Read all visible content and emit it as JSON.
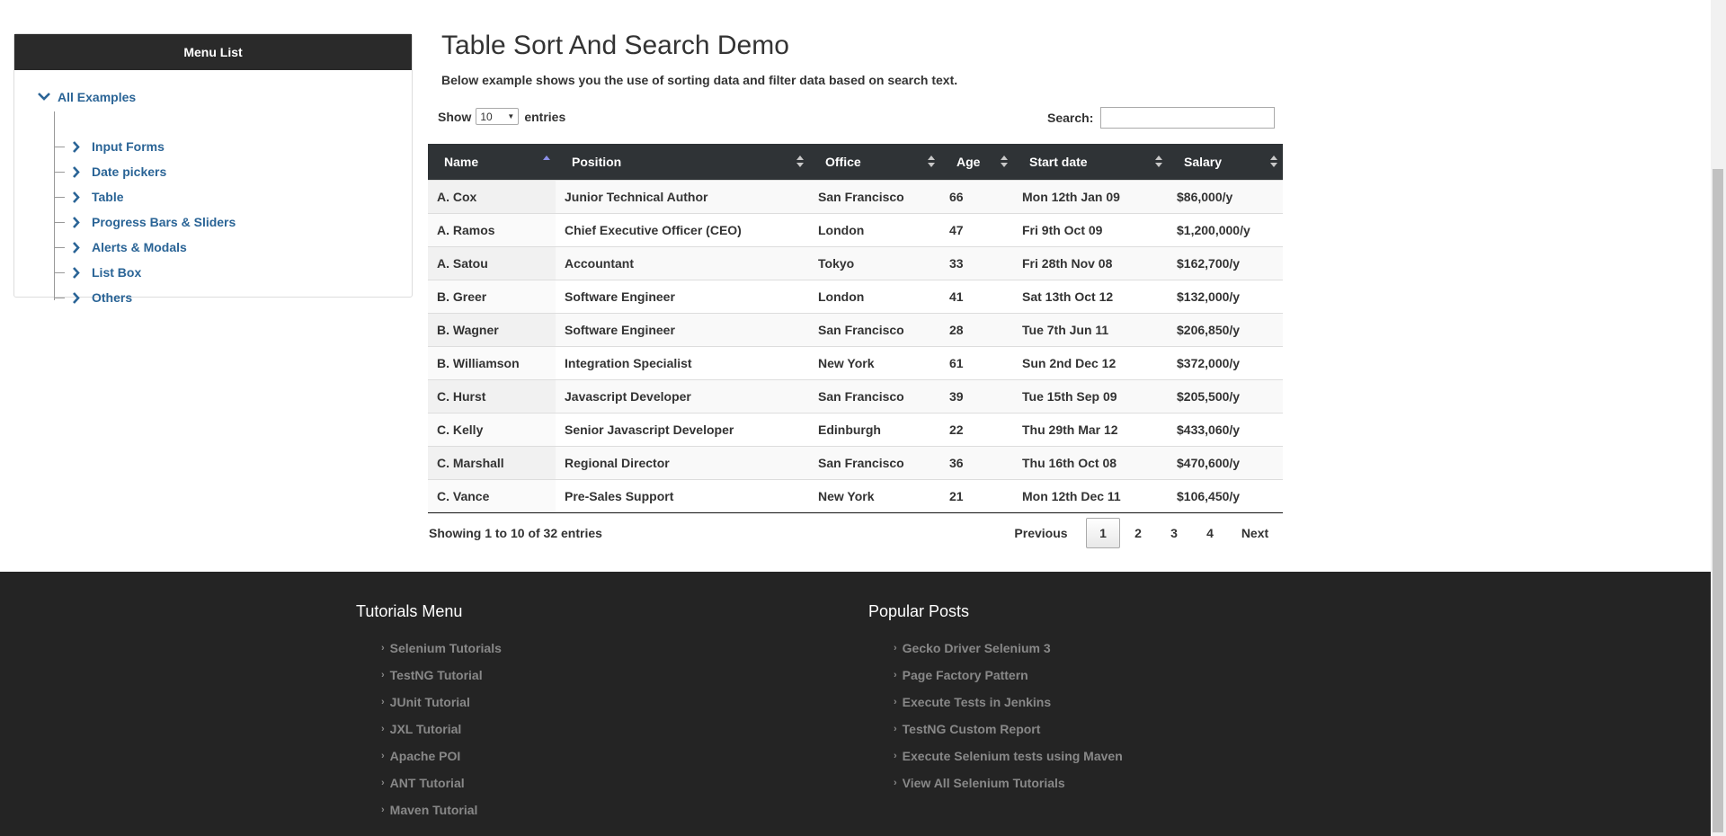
{
  "menu": {
    "title": "Menu List",
    "root_label": "All Examples",
    "items": [
      {
        "label": "Input Forms"
      },
      {
        "label": "Date pickers"
      },
      {
        "label": "Table"
      },
      {
        "label": "Progress Bars & Sliders"
      },
      {
        "label": "Alerts & Modals"
      },
      {
        "label": "List Box"
      },
      {
        "label": "Others"
      }
    ]
  },
  "main": {
    "title": "Table Sort And Search Demo",
    "description": "Below example shows you the use of sorting data and filter data based on search text.",
    "show_label": "Show",
    "entries_value": "10",
    "entries_label": "entries",
    "search_label": "Search:",
    "search_value": ""
  },
  "table": {
    "columns": [
      "Name",
      "Position",
      "Office",
      "Age",
      "Start date",
      "Salary"
    ],
    "rows": [
      [
        "A. Cox",
        "Junior Technical Author",
        "San Francisco",
        "66",
        "Mon 12th Jan 09",
        "$86,000/y"
      ],
      [
        "A. Ramos",
        "Chief Executive Officer (CEO)",
        "London",
        "47",
        "Fri 9th Oct 09",
        "$1,200,000/y"
      ],
      [
        "A. Satou",
        "Accountant",
        "Tokyo",
        "33",
        "Fri 28th Nov 08",
        "$162,700/y"
      ],
      [
        "B. Greer",
        "Software Engineer",
        "London",
        "41",
        "Sat 13th Oct 12",
        "$132,000/y"
      ],
      [
        "B. Wagner",
        "Software Engineer",
        "San Francisco",
        "28",
        "Tue 7th Jun 11",
        "$206,850/y"
      ],
      [
        "B. Williamson",
        "Integration Specialist",
        "New York",
        "61",
        "Sun 2nd Dec 12",
        "$372,000/y"
      ],
      [
        "C. Hurst",
        "Javascript Developer",
        "San Francisco",
        "39",
        "Tue 15th Sep 09",
        "$205,500/y"
      ],
      [
        "C. Kelly",
        "Senior Javascript Developer",
        "Edinburgh",
        "22",
        "Thu 29th Mar 12",
        "$433,060/y"
      ],
      [
        "C. Marshall",
        "Regional Director",
        "San Francisco",
        "36",
        "Thu 16th Oct 08",
        "$470,600/y"
      ],
      [
        "C. Vance",
        "Pre-Sales Support",
        "New York",
        "21",
        "Mon 12th Dec 11",
        "$106,450/y"
      ]
    ],
    "info": "Showing 1 to 10 of 32 entries"
  },
  "pagination": {
    "previous": "Previous",
    "pages": [
      "1",
      "2",
      "3",
      "4"
    ],
    "current": "1",
    "next": "Next"
  },
  "footer": {
    "tutorials_title": "Tutorials Menu",
    "tutorials": [
      "Selenium Tutorials",
      "TestNG Tutorial",
      "JUnit Tutorial",
      "JXL Tutorial",
      "Apache POI",
      "ANT Tutorial",
      "Maven Tutorial"
    ],
    "posts_title": "Popular Posts",
    "posts": [
      "Gecko Driver Selenium 3",
      "Page Factory Pattern",
      "Execute Tests in Jenkins",
      "TestNG Custom Report",
      "Execute Selenium tests using Maven",
      "View All Selenium Tutorials"
    ]
  },
  "colors": {
    "link": "#2a6496",
    "header_bg": "#2f3336",
    "menu_head_bg": "#2a2a2a",
    "footer_bg": "#242424",
    "sort_active": "#8b8fe8"
  },
  "icons": {
    "tree_root": "chevron-down-icon",
    "tree_item": "chevron-right-icon",
    "sort": "sort-both-icon",
    "sort_active": "sort-asc-icon",
    "footer_bullet": "angle-right-icon"
  }
}
